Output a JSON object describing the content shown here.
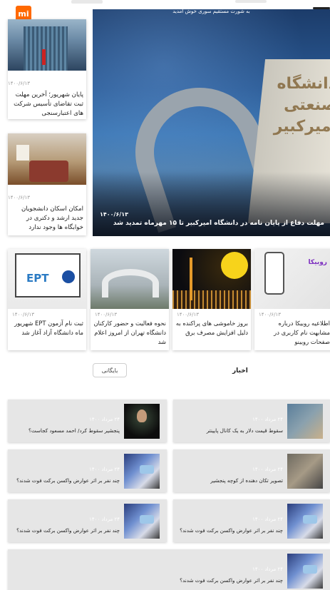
{
  "header": {
    "logo_text": "mi",
    "logo_color": "#ff6900"
  },
  "hero": {
    "top_caption": "به شورت مستقیم سوری خوش آمدید",
    "date": "۱۴۰۰/۶/۱۳",
    "title": "مهلت دفاع از پایان نامه در دانشگاه امیرکبیر تا ۱۵ مهرماه تمدید شد",
    "sign_text": "دانشگاه صنعتی امیرکبیر"
  },
  "left_cards": [
    {
      "date": "۱۴۰۰/۶/۱۳",
      "title": "پایان شهریور؛ آخرین مهلت ثبت تقاضای تأسیس شرکت های اعتبارسنجی"
    },
    {
      "date": "۱۴۰۰/۶/۱۳",
      "title": "امکان اسکان دانشجویان جدید ارشد و دکتری در خوابگاه ها وجود ندارد"
    }
  ],
  "middle_cards": [
    {
      "date": "۱۴۰۰/۶/۱۳",
      "title": "اطلاعیه روبیکا درباره مشابهت نام کاربری در صفحات روبینو",
      "image_text": "روبیکا",
      "image": "rubika"
    },
    {
      "date": "۱۴۰۰/۶/۱۳",
      "title": "بروز خاموشی های پراکنده به دلیل افزایش مصرف برق",
      "image": "power"
    },
    {
      "date": "۱۴۰۰/۶/۱۳",
      "title": "نحوه فعالیت و حضور کارکنان دانشگاه تهران از امروز اعلام شد",
      "image": "uni"
    },
    {
      "date": "۱۴۰۰/۶/۱۳",
      "title": "ثبت نام آزمون EPT شهریور ماه دانشگاه آزاد آغاز شد",
      "image_text": "EPT",
      "image": "ept"
    }
  ],
  "tabs": {
    "news": "اخبار",
    "archive": "بایگانی"
  },
  "news_list": [
    {
      "meta": "۲۴ مرداد ۱۴۰۰",
      "title": "سقوط قیمت دلار به یک کانال پایینتر",
      "thumb": "dollar"
    },
    {
      "meta": "۲۴ مرداد ۱۴۰۰",
      "title": "پنجشیر سقوط کرد/ احمد مسعود کجاست؟",
      "thumb": "panj"
    },
    {
      "meta": "۲۴ مرداد ۱۴۰۰",
      "title": "تصویر تکان دهنده از کوچه پنجشیر",
      "thumb": "quake"
    },
    {
      "meta": "۲۴ مرداد ۱۴۰۰",
      "title": "چند نفر بر اثر عوارض واکسن برکت فوت شدند؟",
      "thumb": "vax"
    },
    {
      "meta": "۲۴ مرداد ۱۴۰۰",
      "title": "چند نفر بر اثر عوارض واکسن برکت فوت شدند؟",
      "thumb": "vax"
    },
    {
      "meta": "۲۴ مرداد ۱۴۰۰",
      "title": "چند نفر بر اثر عوارض واکسن برکت فوت شدند؟",
      "thumb": "vax"
    },
    {
      "meta": "۲۴ مرداد ۱۴۰۰",
      "title": "چند نفر بر اثر عوارض واکسن برکت فوت شدند؟",
      "thumb": "vax"
    }
  ]
}
